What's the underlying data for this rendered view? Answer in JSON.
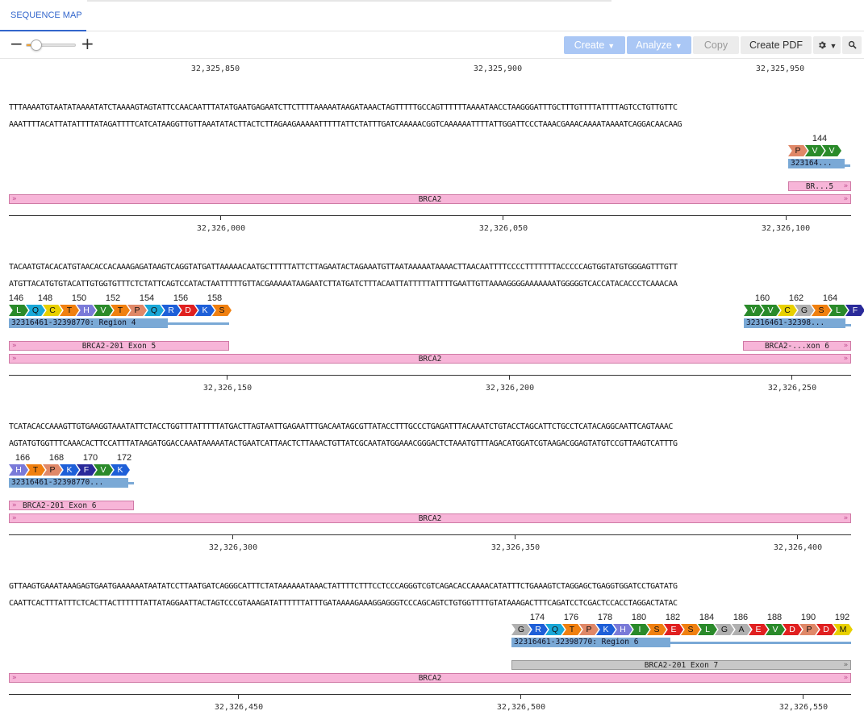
{
  "tab": {
    "label": "SEQUENCE MAP"
  },
  "toolbar": {
    "zoom_minus": "−",
    "zoom_plus": "+",
    "zoom_level": 0.2,
    "create_label": "Create",
    "analyze_label": "Analyze",
    "copy_label": "Copy",
    "create_pdf_label": "Create PDF",
    "settings_icon": "gear-icon",
    "search_icon": "search-icon"
  },
  "colors": {
    "accent": "#3366cc",
    "gene": "#f7b5d8",
    "region": "#7aa9d6",
    "exon_selected": "#c8c8c8"
  },
  "rows": [
    {
      "ruler_top": [
        "32,325,850",
        "32,325,900",
        "32,325,950"
      ],
      "fwd": "TTTAAAATGTAATATAAAATATCTAAAAGTAGTATTCCAACAATTTATATGAATGAGAATCTTCTTTTAAAAATAAGATAAACTAGTTTTTGCCAGTTTTTTAAAATAACCTAAGGGATTTGCTTTGTTTTATTTTAGTCCTGTTGTTC",
      "rev": "AAATTTTACATTATATTTTATAGATTTTCATCATAAGGTTGTTAAATATACTTACTCTTAGAAGAAAAATTTTTATTCTATTTGATCAAAAACGGTCAAAAAATTTTATTGGATTCCCTAAACGAAACAAAATAAAATCAGGACAACAAG",
      "aa_numbers": [
        "144"
      ],
      "aa": [
        "P",
        "V",
        "V"
      ],
      "region_label": "323164...",
      "exon_label": "BR...5",
      "gene_label": "BRCA2",
      "ruler_bottom": [
        "32,326,000",
        "32,326,050",
        "32,326,100"
      ]
    },
    {
      "fwd": "TACAATGTACACATGTAACACCACAAAGAGATAAGTCAGGTATGATTAAAAACAATGCTTTTTATTCTTAGAATACTAGAAATGTTAATAAAAATAAAACTTAACAATTTTCCCCTTTTTTTACCCCCAGTGGTATGTGGGAGTTTGTT",
      "rev": "ATGTTACATGTGTACATTGTGGTGTTTCTCTATTCAGTCCATACTAATTTTTGTTACGAAAAATAAGAATCTTATGATCTTTACAATTATTTTTATTTTGAATTGTTAAAAGGGGAAAAAAATGGGGGTCACCATACACCCTCAAACAA",
      "aa_numbers_left": [
        "146",
        "148",
        "150",
        "152",
        "154",
        "156",
        "158"
      ],
      "aa_left": [
        "L",
        "Q",
        "C",
        "T",
        "H",
        "V",
        "T",
        "P",
        "Q",
        "R",
        "D",
        "K",
        "S"
      ],
      "aa_numbers_right": [
        "160",
        "162",
        "164"
      ],
      "aa_right": [
        "V",
        "V",
        "C",
        "G",
        "S",
        "L",
        "F"
      ],
      "region_left": "32316461-32398770: Region 4",
      "region_right": "32316461-32398...",
      "exon_left": "BRCA2-201 Exon 5",
      "exon_right": "BRCA2-...xon 6",
      "gene_label": "BRCA2",
      "ruler_bottom": [
        "32,326,150",
        "32,326,200",
        "32,326,250"
      ]
    },
    {
      "fwd": "TCATACACCAAAGTTGTGAAGGTAAATATTCTACCTGGTTTATTTTTATGACTTAGTAATTGAGAATTTGACAATAGCGTTATACCTTTGCCCTGAGATTTACAAATCTGTACCTAGCATTCTGCCTCATACAGGCAATTCAGTAAAC",
      "rev": "AGTATGTGGTTTCAAACACTTCCATTTATAAGATGGACCAAATAAAAATACTGAATCATTAACTCTTAAACTGTTATCGCAATATGGAAACGGGACTCTAAATGTTTAGACATGGATCGTAAGACGGAGTATGTCCGTTAAGTCATTTG",
      "aa_numbers": [
        "166",
        "168",
        "170",
        "172"
      ],
      "aa": [
        "H",
        "T",
        "P",
        "K",
        "F",
        "V",
        "K"
      ],
      "region_label": "32316461-32398770...",
      "exon_label": "BRCA2-201 Exon 6",
      "gene_label": "BRCA2",
      "ruler_bottom": [
        "32,326,300",
        "32,326,350",
        "32,326,400"
      ]
    },
    {
      "fwd": "GTTAAGTGAAATAAAGAGTGAATGAAAAAATAATATCCTTAATGATCAGGGCATTTCTATAAAAAATAAACTATTTTCTTTCCTCCCAGGGTCGTCAGACACCAAAACATATTTCTGAAAGTCTAGGAGCTGAGGTGGATCCTGATATG",
      "rev": "CAATTCACTTTATTTCTCACTTACTTTTTTATTATAGGAATTACTAGTCCCGTAAAGATATTTTTTATTTGATAAAAGAAAGGAGGGTCCCAGCAGTCTGTGGTTTTGTATAAAGACTTTCAGATCCTCGACTCCACCTAGGACTATAC",
      "aa_numbers": [
        "174",
        "176",
        "178",
        "180",
        "182",
        "184",
        "186",
        "188",
        "190",
        "192"
      ],
      "aa": [
        "G",
        "R",
        "Q",
        "T",
        "P",
        "K",
        "H",
        "I",
        "S",
        "E",
        "S",
        "L",
        "G",
        "A",
        "E",
        "V",
        "D",
        "P",
        "D",
        "M"
      ],
      "region_label": "32316461-32398770: Region 6",
      "exon_label": "BRCA2-201 Exon 7",
      "gene_label": "BRCA2",
      "ruler_bottom": [
        "32,326,450",
        "32,326,500",
        "32,326,550"
      ]
    }
  ]
}
